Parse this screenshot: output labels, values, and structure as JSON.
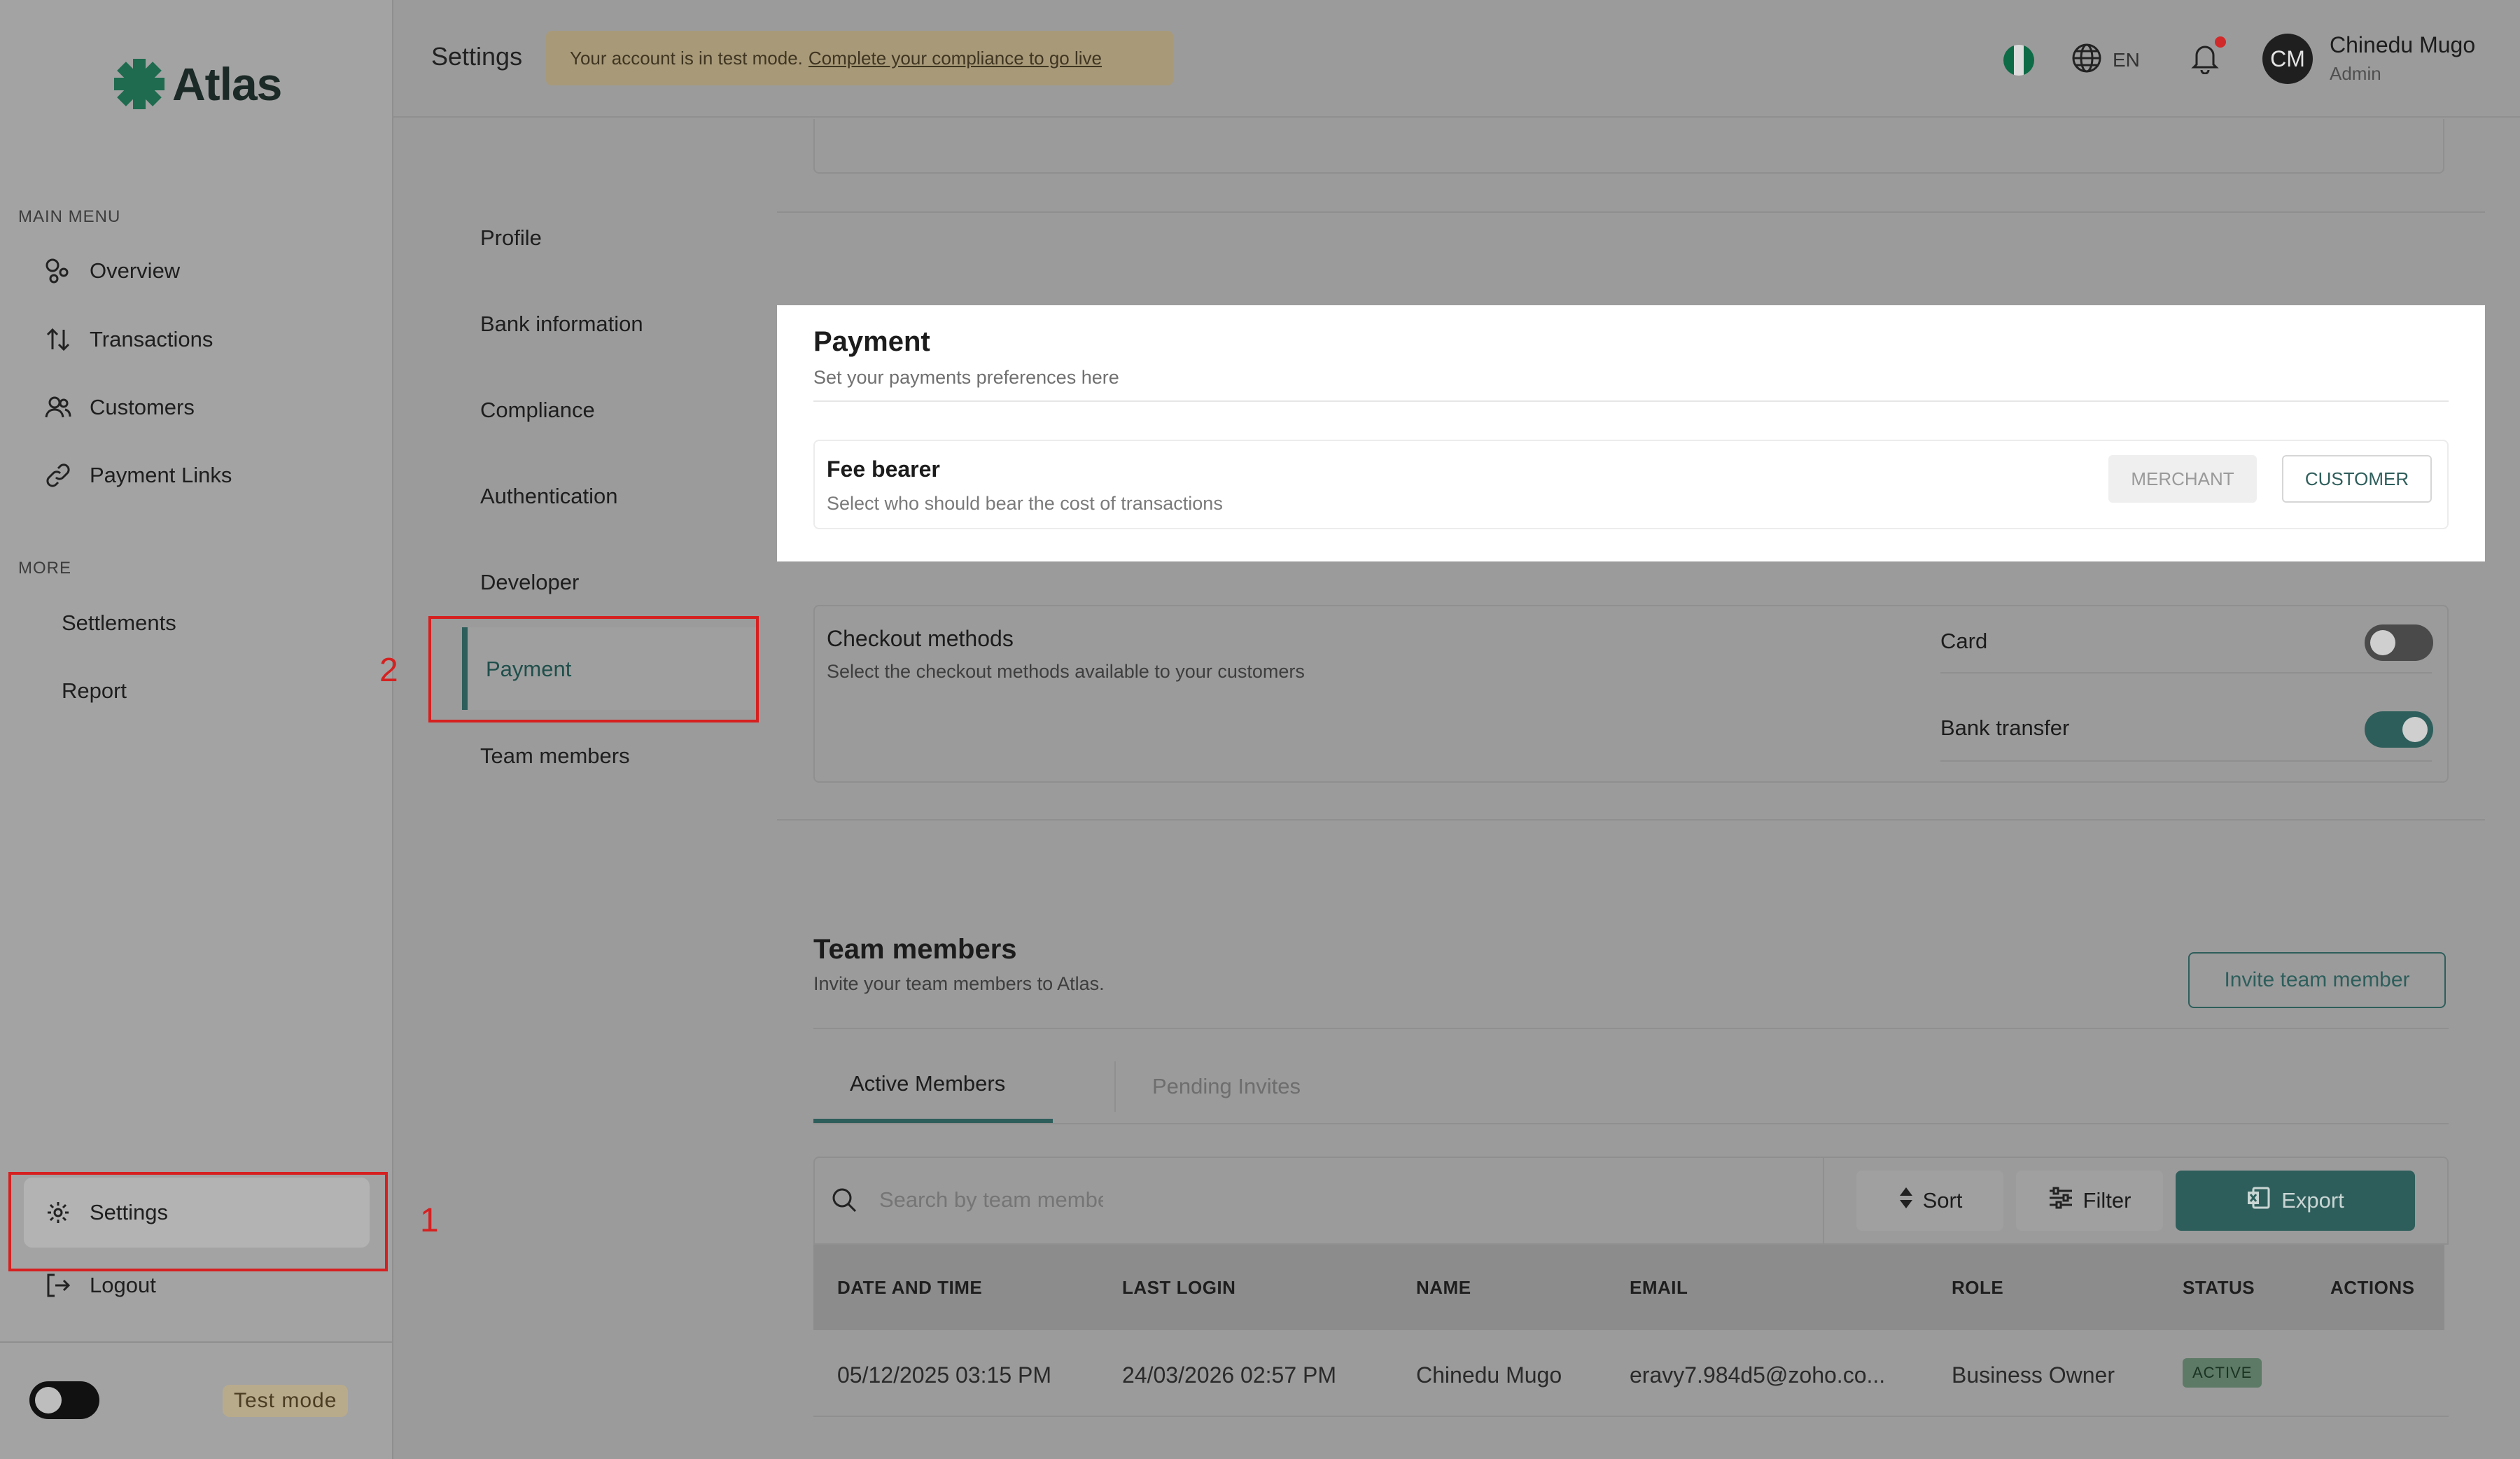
{
  "app": {
    "brand": "Atlas",
    "brand_color": "#1e6b4f"
  },
  "sidebar": {
    "main_menu_label": "MAIN MENU",
    "main_items": [
      {
        "label": "Overview",
        "icon": "overview-icon"
      },
      {
        "label": "Transactions",
        "icon": "arrows-up-down-icon"
      },
      {
        "label": "Customers",
        "icon": "users-icon"
      },
      {
        "label": "Payment Links",
        "icon": "link-icon"
      }
    ],
    "more_label": "MORE",
    "more_items": [
      {
        "label": "Settlements"
      },
      {
        "label": "Report"
      }
    ],
    "settings_label": "Settings",
    "logout_label": "Logout",
    "test_mode_label": "Test mode"
  },
  "header": {
    "title": "Settings",
    "banner_text": "Your account is in test mode.",
    "banner_link": "Complete your compliance to go live",
    "language": "EN",
    "user_initials": "CM",
    "user_name": "Chinedu Mugo",
    "user_role": "Admin"
  },
  "submenu": {
    "items": [
      "Profile",
      "Bank information",
      "Compliance",
      "Authentication",
      "Developer",
      "Payment",
      "Team members"
    ],
    "active": "Payment"
  },
  "payment": {
    "title": "Payment",
    "subtitle": "Set your payments preferences here",
    "fee_bearer_title": "Fee bearer",
    "fee_bearer_desc": "Select who should bear the cost of transactions",
    "merchant_label": "MERCHANT",
    "customer_label": "CUSTOMER",
    "checkout_title": "Checkout methods",
    "checkout_desc": "Select the checkout methods available to your customers",
    "methods": [
      {
        "label": "Card",
        "enabled": false
      },
      {
        "label": "Bank transfer",
        "enabled": true
      }
    ]
  },
  "team": {
    "title": "Team members",
    "subtitle": "Invite your team members to Atlas.",
    "invite_label": "Invite team member",
    "tabs": [
      "Active Members",
      "Pending Invites"
    ],
    "search_placeholder": "Search by team member's name",
    "sort_label": "Sort",
    "filter_label": "Filter",
    "export_label": "Export",
    "columns": [
      "DATE AND TIME",
      "LAST LOGIN",
      "NAME",
      "EMAIL",
      "ROLE",
      "STATUS",
      "ACTIONS"
    ],
    "rows": [
      {
        "date": "05/12/2025 03:15 PM",
        "last_login": "24/03/2026 02:57 PM",
        "name": "Chinedu Mugo",
        "email": "eravy7.984d5@zoho.co...",
        "role": "Business Owner",
        "status": "ACTIVE"
      }
    ]
  },
  "annotations": {
    "first": "1",
    "second": "2"
  }
}
